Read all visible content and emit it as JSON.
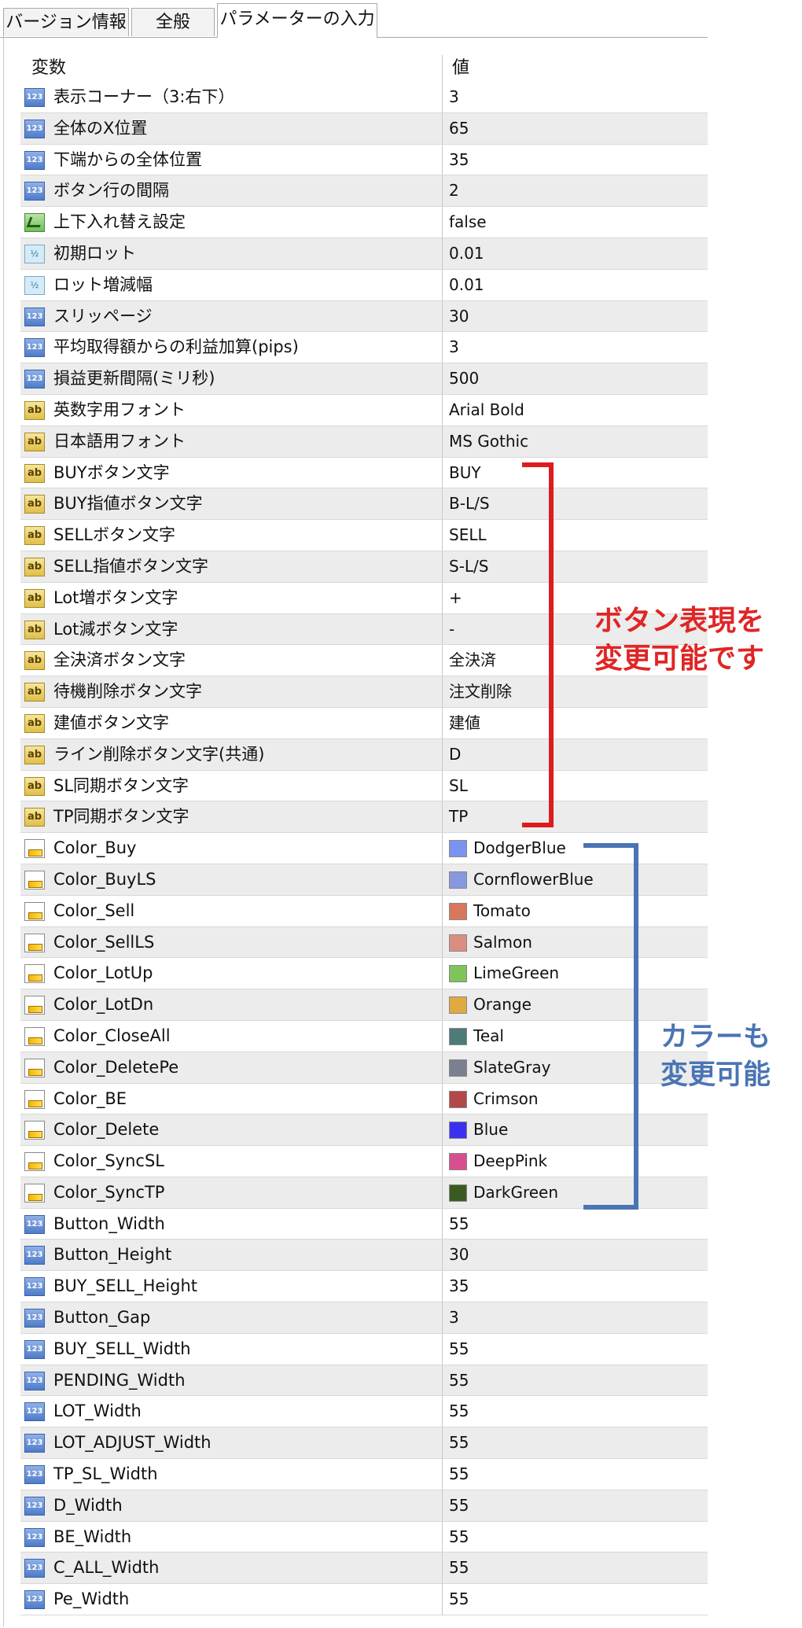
{
  "tabs": [
    {
      "label": "バージョン情報"
    },
    {
      "label": "全般"
    },
    {
      "label": "パラメーターの入力"
    }
  ],
  "table": {
    "col_variable": "変数",
    "col_value": "値",
    "rows": [
      {
        "type": "int",
        "name": "表示コーナー（3:右下）",
        "value": "3"
      },
      {
        "type": "int",
        "name": "全体のX位置",
        "value": "65"
      },
      {
        "type": "int",
        "name": "下端からの全体位置",
        "value": "35"
      },
      {
        "type": "int",
        "name": "ボタン行の間隔",
        "value": "2"
      },
      {
        "type": "bool",
        "name": "上下入れ替え設定",
        "value": "false"
      },
      {
        "type": "double",
        "name": "初期ロット",
        "value": "0.01"
      },
      {
        "type": "double",
        "name": "ロット増減幅",
        "value": "0.01"
      },
      {
        "type": "int",
        "name": "スリッページ",
        "value": "30"
      },
      {
        "type": "int",
        "name": "平均取得額からの利益加算(pips)",
        "value": "3"
      },
      {
        "type": "int",
        "name": "損益更新間隔(ミリ秒)",
        "value": "500"
      },
      {
        "type": "string",
        "name": "英数字用フォント",
        "value": "Arial Bold"
      },
      {
        "type": "string",
        "name": "日本語用フォント",
        "value": "MS Gothic"
      },
      {
        "type": "string",
        "name": "BUYボタン文字",
        "value": "BUY"
      },
      {
        "type": "string",
        "name": "BUY指値ボタン文字",
        "value": "B-L/S"
      },
      {
        "type": "string",
        "name": "SELLボタン文字",
        "value": "SELL"
      },
      {
        "type": "string",
        "name": "SELL指値ボタン文字",
        "value": "S-L/S"
      },
      {
        "type": "string",
        "name": "Lot増ボタン文字",
        "value": "+"
      },
      {
        "type": "string",
        "name": "Lot減ボタン文字",
        "value": "-"
      },
      {
        "type": "string",
        "name": "全決済ボタン文字",
        "value": "全決済"
      },
      {
        "type": "string",
        "name": "待機削除ボタン文字",
        "value": "注文削除"
      },
      {
        "type": "string",
        "name": "建値ボタン文字",
        "value": "建値"
      },
      {
        "type": "string",
        "name": "ライン削除ボタン文字(共通)",
        "value": "D"
      },
      {
        "type": "string",
        "name": "SL同期ボタン文字",
        "value": "SL"
      },
      {
        "type": "string",
        "name": "TP同期ボタン文字",
        "value": "TP"
      },
      {
        "type": "color",
        "name": "Color_Buy",
        "value": "DodgerBlue",
        "swatch": "#7b93f0"
      },
      {
        "type": "color",
        "name": "Color_BuyLS",
        "value": "CornflowerBlue",
        "swatch": "#8797e0"
      },
      {
        "type": "color",
        "name": "Color_Sell",
        "value": "Tomato",
        "swatch": "#d9775a"
      },
      {
        "type": "color",
        "name": "Color_SellLS",
        "value": "Salmon",
        "swatch": "#d98e80"
      },
      {
        "type": "color",
        "name": "Color_LotUp",
        "value": "LimeGreen",
        "swatch": "#7ec45a"
      },
      {
        "type": "color",
        "name": "Color_LotDn",
        "value": "Orange",
        "swatch": "#e0aa40"
      },
      {
        "type": "color",
        "name": "Color_CloseAll",
        "value": "Teal",
        "swatch": "#4e7a7a"
      },
      {
        "type": "color",
        "name": "Color_DeletePe",
        "value": "SlateGray",
        "swatch": "#7a8090"
      },
      {
        "type": "color",
        "name": "Color_BE",
        "value": "Crimson",
        "swatch": "#b34848"
      },
      {
        "type": "color",
        "name": "Color_Delete",
        "value": "Blue",
        "swatch": "#3a30f0"
      },
      {
        "type": "color",
        "name": "Color_SyncSL",
        "value": "DeepPink",
        "swatch": "#d6508e"
      },
      {
        "type": "color",
        "name": "Color_SyncTP",
        "value": "DarkGreen",
        "swatch": "#3a5a22"
      },
      {
        "type": "int",
        "name": "Button_Width",
        "value": "55"
      },
      {
        "type": "int",
        "name": "Button_Height",
        "value": "30"
      },
      {
        "type": "int",
        "name": "BUY_SELL_Height",
        "value": "35"
      },
      {
        "type": "int",
        "name": "Button_Gap",
        "value": "3"
      },
      {
        "type": "int",
        "name": "BUY_SELL_Width",
        "value": "55"
      },
      {
        "type": "int",
        "name": "PENDING_Width",
        "value": "55"
      },
      {
        "type": "int",
        "name": "LOT_Width",
        "value": "55"
      },
      {
        "type": "int",
        "name": "LOT_ADJUST_Width",
        "value": "55"
      },
      {
        "type": "int",
        "name": "TP_SL_Width",
        "value": "55"
      },
      {
        "type": "int",
        "name": "D_Width",
        "value": "55"
      },
      {
        "type": "int",
        "name": "BE_Width",
        "value": "55"
      },
      {
        "type": "int",
        "name": "C_ALL_Width",
        "value": "55"
      },
      {
        "type": "int",
        "name": "Pe_Width",
        "value": "55"
      }
    ]
  },
  "icons": {
    "int": "123",
    "double": "½",
    "string": "ab",
    "bool": "",
    "color": ""
  },
  "annotations": {
    "red_line1": "ボタン表現を",
    "red_line2": "変更可能です",
    "blue_line1": "カラーも",
    "blue_line2": "変更可能",
    "red_color": "#e02525",
    "blue_color": "#4a74b4"
  }
}
